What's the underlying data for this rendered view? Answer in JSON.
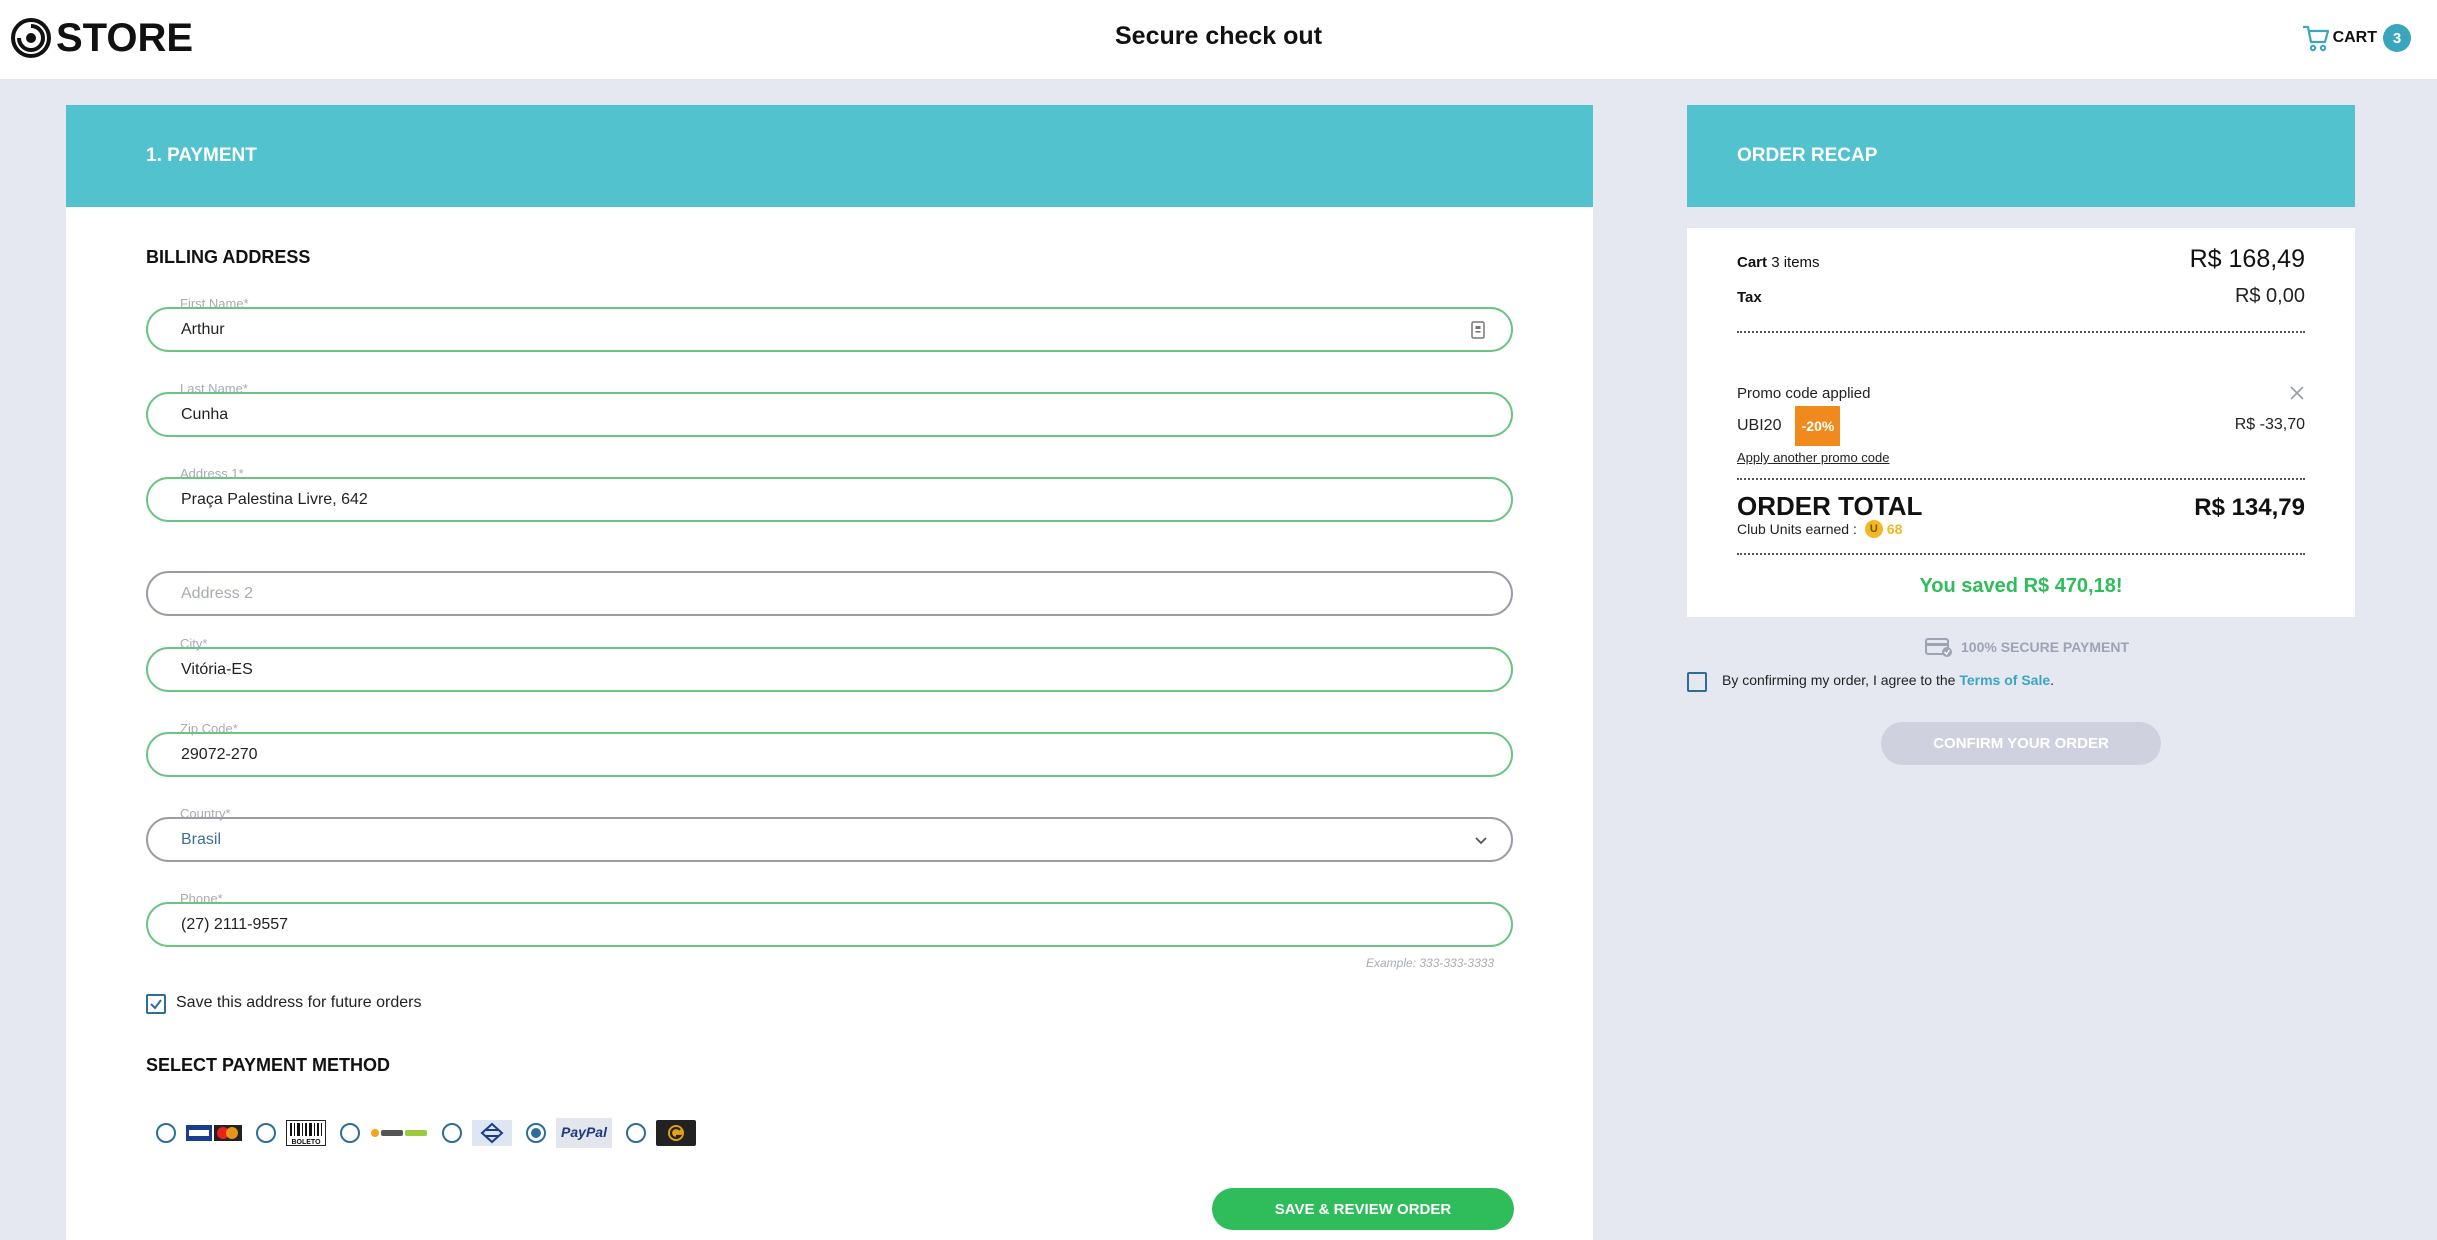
{
  "header": {
    "logo_text": "STORE",
    "title": "Secure check out",
    "cart_label": "CART",
    "cart_count": "3"
  },
  "payment": {
    "section_heading": "1. PAYMENT",
    "billing_heading": "BILLING ADDRESS",
    "fields": {
      "first_name": {
        "label": "First Name*",
        "value": "Arthur"
      },
      "last_name": {
        "label": "Last Name*",
        "value": "Cunha"
      },
      "address1": {
        "label": "Address 1*",
        "value": "Praça Palestina Livre, 642"
      },
      "address2": {
        "placeholder": "Address 2",
        "value": ""
      },
      "city": {
        "label": "City*",
        "value": "Vitória-ES"
      },
      "zip": {
        "label": "Zip Code*",
        "value": "29072-270"
      },
      "country": {
        "label": "Country*",
        "value": "Brasil"
      },
      "phone": {
        "label": "Phone*",
        "value": "(27) 2111-9557",
        "hint": "Example: 333-333-3333"
      }
    },
    "save_address_label": "Save this address for future orders",
    "save_address_checked": true,
    "method_heading": "SELECT PAYMENT METHOD",
    "methods": [
      {
        "name": "credit-card",
        "selected": false
      },
      {
        "name": "boleto",
        "label": "BOLETO",
        "selected": false
      },
      {
        "name": "pagseguro",
        "selected": false
      },
      {
        "name": "banco-do-brasil",
        "selected": false
      },
      {
        "name": "paypal",
        "label": "PayPal",
        "selected": true
      },
      {
        "name": "gift-card",
        "selected": false
      }
    ],
    "save_review_label": "SAVE & REVIEW ORDER"
  },
  "recap": {
    "heading": "ORDER RECAP",
    "cart_label": "Cart",
    "cart_items": "3 items",
    "cart_value": "R$ 168,49",
    "tax_label": "Tax",
    "tax_value": "R$ 0,00",
    "promo_applied_label": "Promo code applied",
    "promo_code": "UBI20",
    "promo_badge": "-20%",
    "promo_amount": "R$ -33,70",
    "promo_link": "Apply another promo code",
    "total_label": "ORDER TOTAL",
    "total_value": "R$ 134,79",
    "units_label": "Club Units earned :",
    "units_value": "68",
    "saved_text": "You saved R$ 470,18!"
  },
  "checkout": {
    "secure_label": "100% SECURE PAYMENT",
    "terms_prefix": "By confirming my order, I agree to the",
    "terms_link": "Terms of Sale",
    "terms_suffix": ".",
    "confirm_label": "CONFIRM YOUR ORDER"
  },
  "colors": {
    "accent_teal": "#52c2cf",
    "field_valid_green": "#6bc582",
    "button_green": "#2ebd5a",
    "promo_orange": "#f08a1c",
    "background": "#e6e8f1"
  }
}
